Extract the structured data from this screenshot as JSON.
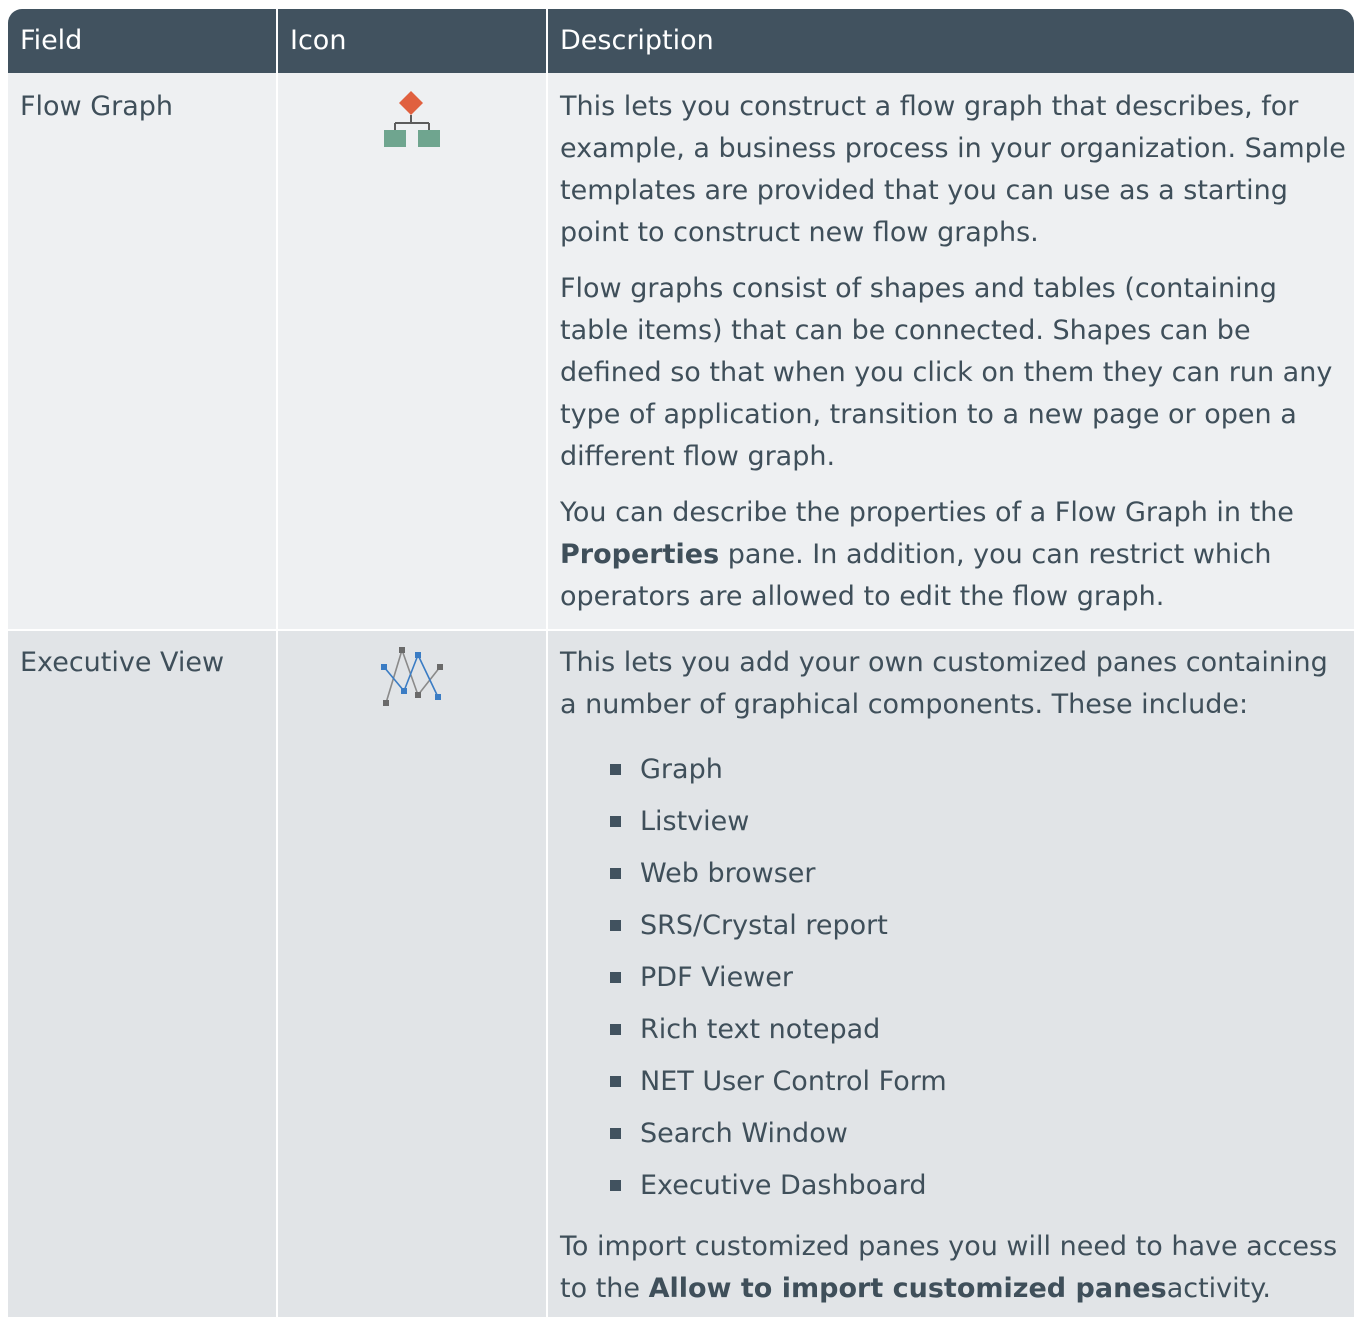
{
  "header": {
    "field": "Field",
    "icon": "Icon",
    "description": "Description"
  },
  "rows": [
    {
      "field": "Flow Graph",
      "icon": "flow-graph-icon",
      "paragraphs": [
        "This lets you construct a flow graph that describes, for example, a business process in your organization. Sample templates are provided that you can use as a starting point to construct new flow graphs.",
        "Flow graphs consist of shapes and tables (containing table items) that can be connected. Shapes can be defined so that when you click on them they can run any type of application, transition to a new page or open a different flow graph."
      ],
      "p3": {
        "pre": "You can describe the properties of a Flow Graph in the ",
        "bold": "Properties",
        "post": " pane. In addition, you can restrict which operators are allowed to edit the flow graph."
      }
    },
    {
      "field": "Executive View",
      "icon": "executive-view-icon",
      "intro": "This lets you add your own customized panes containing a number of graphical components. These include:",
      "items": [
        "Graph",
        "Listview",
        "Web browser",
        "SRS/Crystal report",
        "PDF Viewer",
        "Rich text notepad",
        "NET User Control Form",
        "Search Window",
        "Executive Dashboard"
      ],
      "outro": {
        "pre": "To import customized panes you will need to have access to the ",
        "bold": "Allow to import customized panes",
        "post": "activity."
      }
    }
  ],
  "colors": {
    "header_bg": "#41525f",
    "row1_bg": "#eef0f2",
    "row2_bg": "#e1e4e7",
    "text": "#3f4f5a",
    "flow_diamond": "#e0603f",
    "flow_box": "#6fa58f",
    "exec_blue": "#3a7cc4",
    "exec_gray": "#6a6a6a"
  }
}
